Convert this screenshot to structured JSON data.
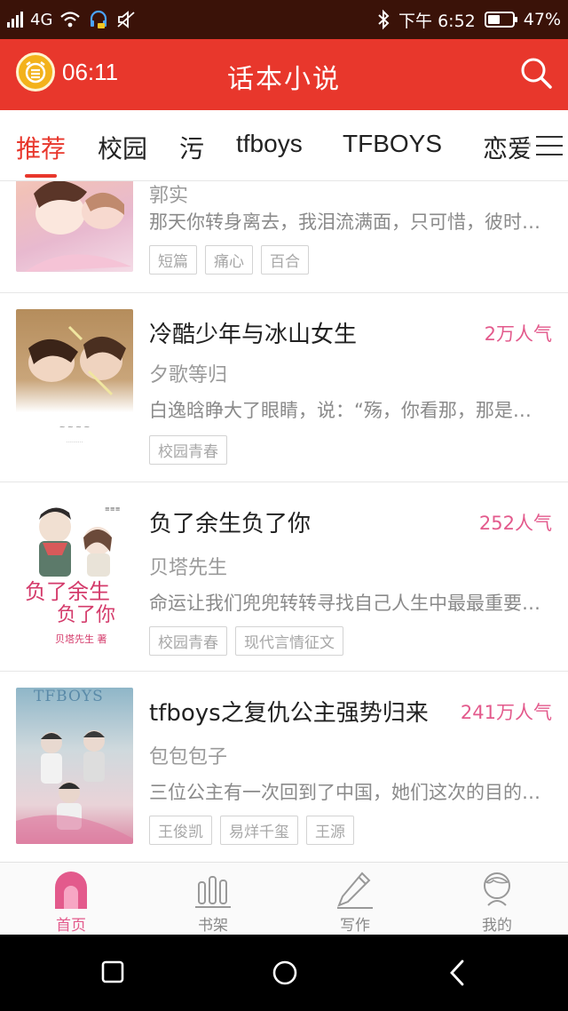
{
  "status_bar": {
    "network": "4G",
    "time": "下午 6:52",
    "battery": "47%"
  },
  "header": {
    "timer": "06:11",
    "title": "话本小说"
  },
  "tabs": [
    {
      "label": "推荐",
      "active": true
    },
    {
      "label": "校园"
    },
    {
      "label": "污"
    },
    {
      "label": "tfboys"
    },
    {
      "label": "TFBOYS"
    },
    {
      "label": "恋爱"
    }
  ],
  "stories": [
    {
      "title": "",
      "popularity": "",
      "author": "郭实",
      "description": "那天你转身离去，我泪流满面，只可惜，彼时的你再也看不见",
      "tags": [
        "短篇",
        "痛心",
        "百合"
      ]
    },
    {
      "title": "冷酷少年与冰山女生",
      "popularity": "2万人气",
      "author": "夕歌等归",
      "description": "白逸晗睁大了眼睛，说：“殇，你看那，那是什么”",
      "tags": [
        "校园青春"
      ]
    },
    {
      "title": "负了余生负了你",
      "popularity": "252人气",
      "author": "贝塔先生",
      "description": "命运让我们兜兜转转寻找自己人生中最最重要的那个人",
      "tags": [
        "校园青春",
        "现代言情征文"
      ],
      "cover_text": [
        "负了余生",
        "负了你",
        "贝塔先生 著"
      ]
    },
    {
      "title": "tfboys之复仇公主强势归来",
      "popularity": "241万人气",
      "author": "包包包子",
      "description": "三位公主有一次回到了中国，她们这次的目的是复仇",
      "tags": [
        "王俊凯",
        "易烊千玺",
        "王源"
      ],
      "cover_text": [
        "TFBOYS"
      ]
    }
  ],
  "bottom_nav": [
    {
      "label": "首页",
      "icon": "home-icon",
      "active": true
    },
    {
      "label": "书架",
      "icon": "bookshelf-icon"
    },
    {
      "label": "写作",
      "icon": "pen-icon"
    },
    {
      "label": "我的",
      "icon": "profile-icon"
    }
  ],
  "colors": {
    "brand": "#e8372c",
    "popularity": "#e35a8c",
    "status_bar": "#3a1208"
  }
}
